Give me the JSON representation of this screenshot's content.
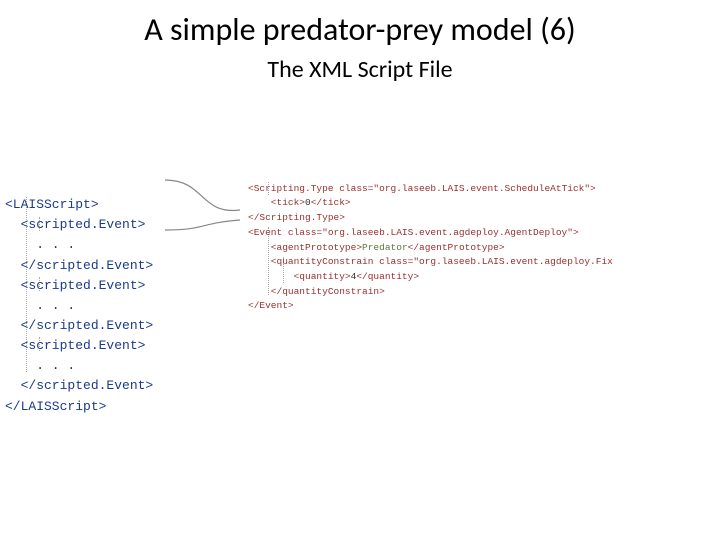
{
  "title": "A simple predator-prey model (6)",
  "subtitle": "The XML Script File",
  "left": {
    "open_root": "<LAISScript>",
    "open_se": "  <scripted.Event>",
    "dots": "    . . .",
    "close_se": "  </scripted.Event>",
    "close_root": "</LAISScript>"
  },
  "right": {
    "l1": "<Scripting.Type class=\"org.laseeb.LAIS.event.ScheduleAtTick\">",
    "l2a": "    <tick>",
    "l2b": "0",
    "l2c": "</tick>",
    "l3": "</Scripting.Type>",
    "l4": "<Event class=\"org.laseeb.LAIS.event.agdeploy.AgentDeploy\">",
    "l5a": "    <agentPrototype>",
    "l5b": "Predator",
    "l5c": "</agentPrototype>",
    "l6": "    <quantityConstrain class=\"org.laseeb.LAIS.event.agdeploy.Fix",
    "l7a": "        <quantity>",
    "l7b": "4",
    "l7c": "</quantity>",
    "l8": "    </quantityConstrain>",
    "l9": "</Event>"
  }
}
